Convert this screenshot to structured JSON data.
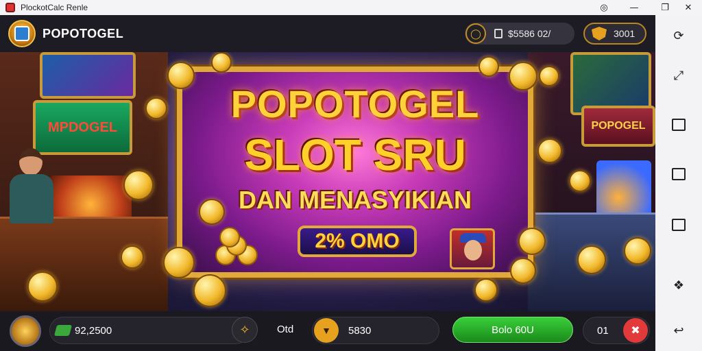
{
  "window": {
    "title": "PlockotCalc Renle",
    "controls": [
      "help-icon",
      "minimize-icon",
      "restore-icon",
      "close-icon"
    ]
  },
  "header": {
    "brand": "POPOTOGEL",
    "pill_a_value": "$5586 02/",
    "pill_b_value": "3001",
    "accent": "#e0a93a"
  },
  "banner": {
    "line1": "POPOTOGEL",
    "line2": "SLOT SRU",
    "line3": "DAN MENASYIKIAN",
    "promo": "2% OMO",
    "left_cabinet_text": "MPDOGEL",
    "right_cabinet_text": "POPOGEL"
  },
  "bottombar": {
    "balance": "92,2500",
    "odd_label": "Otd",
    "mid_value": "5830",
    "spin_label": "Bolo 60U",
    "counter": "01",
    "spin_color": "#2fb52f",
    "close_color": "#e23a3a"
  },
  "sidebar": {
    "buttons": [
      "rotate-icon",
      "fullscreen-icon",
      "square-icon",
      "folder-icon",
      "screenshot-icon",
      "puzzle-icon",
      "back-icon"
    ]
  }
}
